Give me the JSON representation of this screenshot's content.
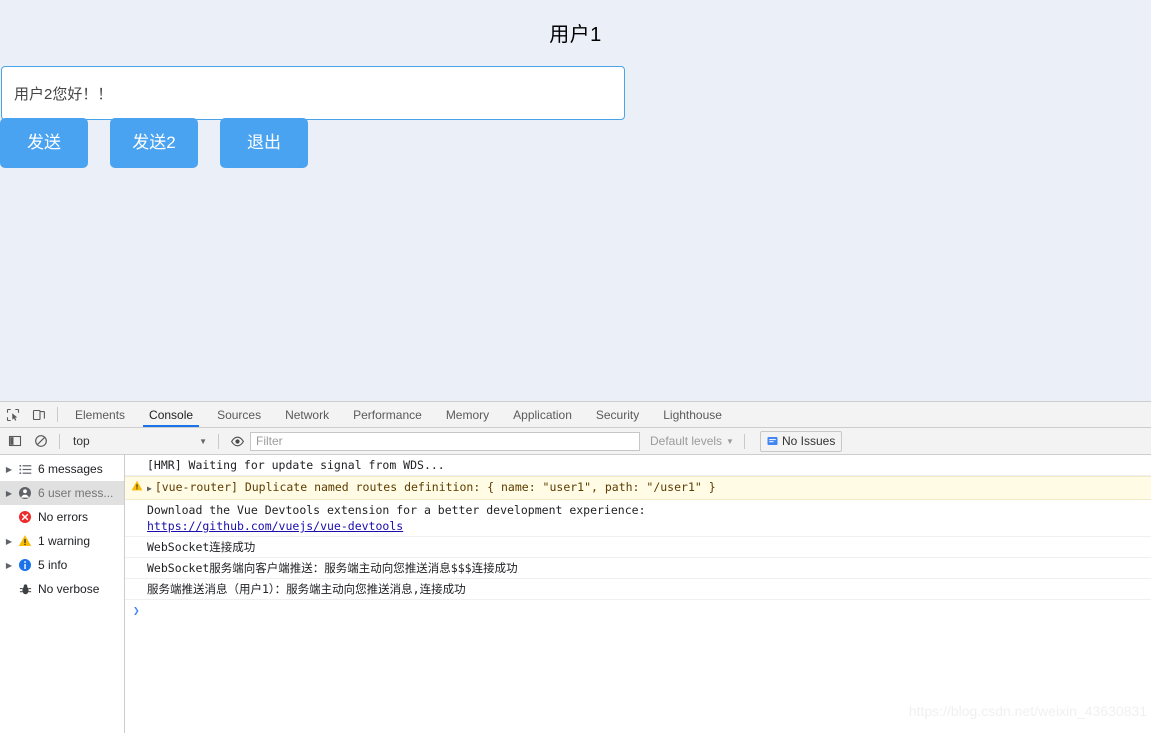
{
  "page": {
    "title": "用户1",
    "input": {
      "value": "用户2您好！！",
      "placeholder": ""
    },
    "buttons": [
      {
        "label": "发送"
      },
      {
        "label": "发送2"
      },
      {
        "label": "退出"
      }
    ],
    "background_color": "#eaeff8",
    "accent_color": "#4aa3f0"
  },
  "devtools": {
    "tabs": [
      {
        "label": "Elements",
        "active": false
      },
      {
        "label": "Console",
        "active": true
      },
      {
        "label": "Sources",
        "active": false
      },
      {
        "label": "Network",
        "active": false
      },
      {
        "label": "Performance",
        "active": false
      },
      {
        "label": "Memory",
        "active": false
      },
      {
        "label": "Application",
        "active": false
      },
      {
        "label": "Security",
        "active": false
      },
      {
        "label": "Lighthouse",
        "active": false
      }
    ],
    "active_tab_underline_color": "#1a73e8",
    "filter_bar": {
      "context": "top",
      "filter_placeholder": "Filter",
      "filter_value": "",
      "levels_label": "Default levels",
      "issues_label": "No Issues"
    },
    "sidebar": [
      {
        "label": "6 messages",
        "icon": "list-icon",
        "expandable": true,
        "selected": false
      },
      {
        "label": "6 user mess...",
        "icon": "user-icon",
        "expandable": true,
        "selected": true
      },
      {
        "label": "No errors",
        "icon": "error-icon",
        "expandable": false,
        "selected": false
      },
      {
        "label": "1 warning",
        "icon": "warning-icon",
        "expandable": true,
        "selected": false
      },
      {
        "label": "5 info",
        "icon": "info-icon",
        "expandable": true,
        "selected": false
      },
      {
        "label": "No verbose",
        "icon": "bug-icon",
        "expandable": false,
        "selected": false
      }
    ],
    "messages": [
      {
        "type": "log",
        "text": "[HMR] Waiting for update signal from WDS..."
      },
      {
        "type": "warning",
        "text": "[vue-router] Duplicate named routes definition: { name: \"user1\", path: \"/user1\" }"
      },
      {
        "type": "log",
        "text": "Download the Vue Devtools extension for a better development experience:",
        "link": "https://github.com/vuejs/vue-devtools"
      },
      {
        "type": "log",
        "text": "WebSocket连接成功"
      },
      {
        "type": "log",
        "text": "WebSocket服务端向客户端推送：服务端主动向您推送消息$$$连接成功"
      },
      {
        "type": "log",
        "text": "服务端推送消息（用户1）：服务端主动向您推送消息,连接成功"
      }
    ],
    "prompt_symbol": "❯"
  },
  "watermark": "https://blog.csdn.net/weixin_43630831"
}
